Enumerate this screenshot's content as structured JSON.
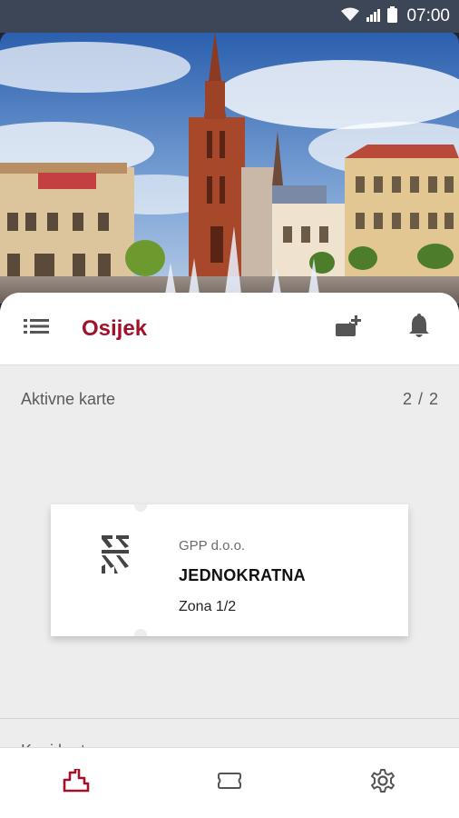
{
  "status_bar": {
    "time": "07:00"
  },
  "header": {
    "title": "Osijek"
  },
  "tickets_section": {
    "label": "Aktivne karte",
    "count": "2 / 2"
  },
  "ticket": {
    "operator": "GPP d.o.o.",
    "type": "JEDNOKRATNA",
    "zone": "Zona 1/2"
  },
  "next_section": {
    "label": "Kupi kartu"
  },
  "icons": {
    "menu": "list-icon",
    "add_card": "add-wallet-icon",
    "notifications": "bell-icon",
    "nav_home": "city-icon",
    "nav_tickets": "ticket-icon",
    "nav_settings": "gear-icon"
  },
  "colors": {
    "accent": "#a1122a",
    "background": "#ededed"
  }
}
